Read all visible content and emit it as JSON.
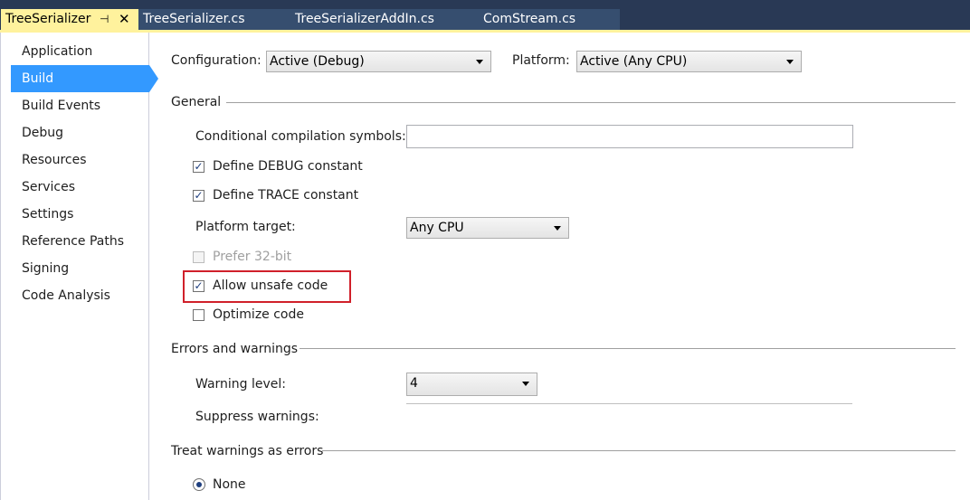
{
  "tabs": {
    "active": {
      "label": "TreeSerializer",
      "pin_icon": "pin-icon",
      "close_icon": "close-icon"
    },
    "items": [
      {
        "label": "TreeSerializer.cs"
      },
      {
        "label": "TreeSerializerAddIn.cs"
      },
      {
        "label": "ComStream.cs"
      }
    ]
  },
  "sidebar": {
    "items": [
      {
        "label": "Application"
      },
      {
        "label": "Build"
      },
      {
        "label": "Build Events"
      },
      {
        "label": "Debug"
      },
      {
        "label": "Resources"
      },
      {
        "label": "Services"
      },
      {
        "label": "Settings"
      },
      {
        "label": "Reference Paths"
      },
      {
        "label": "Signing"
      },
      {
        "label": "Code Analysis"
      }
    ],
    "selected": "Build"
  },
  "toolbar": {
    "configuration_label": "Configuration:",
    "configuration_value": "Active (Debug)",
    "platform_label": "Platform:",
    "platform_value": "Active (Any CPU)"
  },
  "general": {
    "title": "General",
    "conditional_symbols_label": "Conditional compilation symbols:",
    "conditional_symbols_value": "",
    "define_debug_label": "Define DEBUG constant",
    "define_debug_checked": true,
    "define_trace_label": "Define TRACE constant",
    "define_trace_checked": true,
    "platform_target_label": "Platform target:",
    "platform_target_value": "Any CPU",
    "prefer32_label": "Prefer 32-bit",
    "prefer32_checked": false,
    "prefer32_enabled": false,
    "allow_unsafe_label": "Allow unsafe code",
    "allow_unsafe_checked": true,
    "optimize_label": "Optimize code",
    "optimize_checked": false
  },
  "errors": {
    "title": "Errors and warnings",
    "warning_level_label": "Warning level:",
    "warning_level_value": "4",
    "suppress_label": "Suppress warnings:",
    "suppress_value": ""
  },
  "treat": {
    "title": "Treat warnings as errors",
    "none_label": "None",
    "none_selected": true
  },
  "colors": {
    "accent": "#3399ff",
    "tab_active": "#fff29d",
    "tab_bar": "#293955",
    "highlight": "#d0202a"
  },
  "icons": {
    "checked_glyph": "✓",
    "pin_glyph": "⊣",
    "close_glyph": "✕"
  }
}
